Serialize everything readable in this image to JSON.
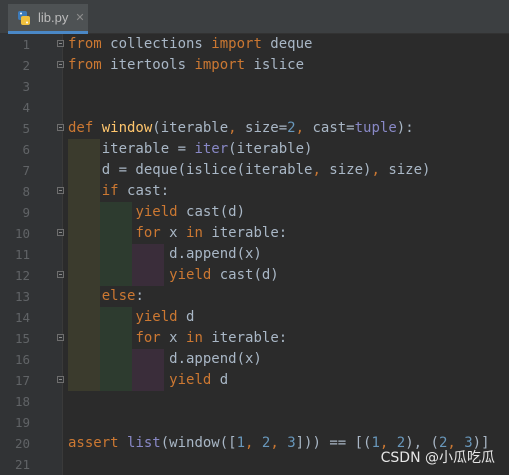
{
  "tab": {
    "filename": "lib.py",
    "close": "✕",
    "icon": "python-file-icon"
  },
  "lines": [
    {
      "n": "1",
      "fold": true,
      "tokens": [
        [
          "kw",
          "from"
        ],
        [
          "t",
          " collections "
        ],
        [
          "kw",
          "import"
        ],
        [
          "t",
          " deque"
        ]
      ]
    },
    {
      "n": "2",
      "fold": true,
      "tokens": [
        [
          "kw",
          "from"
        ],
        [
          "t",
          " itertools "
        ],
        [
          "kw",
          "import"
        ],
        [
          "t",
          " islice"
        ]
      ]
    },
    {
      "n": "3",
      "fold": false,
      "tokens": []
    },
    {
      "n": "4",
      "fold": false,
      "tokens": []
    },
    {
      "n": "5",
      "fold": true,
      "tokens": [
        [
          "kw",
          "def "
        ],
        [
          "fn",
          "window"
        ],
        [
          "t",
          "(iterable"
        ],
        [
          "kw",
          ", "
        ],
        [
          "t",
          "size="
        ],
        [
          "num",
          "2"
        ],
        [
          "kw",
          ", "
        ],
        [
          "t",
          "cast="
        ],
        [
          "bi",
          "tuple"
        ],
        [
          "t",
          "):"
        ]
      ]
    },
    {
      "n": "6",
      "fold": false,
      "tokens": [
        [
          "t",
          "    iterable = "
        ],
        [
          "bi",
          "iter"
        ],
        [
          "t",
          "(iterable)"
        ]
      ]
    },
    {
      "n": "7",
      "fold": false,
      "tokens": [
        [
          "t",
          "    d = deque(islice(iterable"
        ],
        [
          "kw",
          ", "
        ],
        [
          "t",
          "size)"
        ],
        [
          "kw",
          ", "
        ],
        [
          "t",
          "size)"
        ]
      ]
    },
    {
      "n": "8",
      "fold": true,
      "tokens": [
        [
          "t",
          "    "
        ],
        [
          "kw",
          "if "
        ],
        [
          "t",
          "cast:"
        ]
      ]
    },
    {
      "n": "9",
      "fold": false,
      "tokens": [
        [
          "t",
          "        "
        ],
        [
          "kw",
          "yield "
        ],
        [
          "t",
          "cast(d)"
        ]
      ]
    },
    {
      "n": "10",
      "fold": true,
      "tokens": [
        [
          "t",
          "        "
        ],
        [
          "kw",
          "for "
        ],
        [
          "t",
          "x "
        ],
        [
          "kw",
          "in "
        ],
        [
          "t",
          "iterable:"
        ]
      ]
    },
    {
      "n": "11",
      "fold": false,
      "tokens": [
        [
          "t",
          "            d.append(x)"
        ]
      ]
    },
    {
      "n": "12",
      "fold": true,
      "tokens": [
        [
          "t",
          "            "
        ],
        [
          "kw",
          "yield "
        ],
        [
          "t",
          "cast(d)"
        ]
      ]
    },
    {
      "n": "13",
      "fold": false,
      "tokens": [
        [
          "t",
          "    "
        ],
        [
          "kw",
          "else"
        ],
        [
          "t",
          ":"
        ]
      ]
    },
    {
      "n": "14",
      "fold": false,
      "tokens": [
        [
          "t",
          "        "
        ],
        [
          "kw",
          "yield "
        ],
        [
          "t",
          "d"
        ]
      ]
    },
    {
      "n": "15",
      "fold": true,
      "tokens": [
        [
          "t",
          "        "
        ],
        [
          "kw",
          "for "
        ],
        [
          "t",
          "x "
        ],
        [
          "kw",
          "in "
        ],
        [
          "t",
          "iterable:"
        ]
      ]
    },
    {
      "n": "16",
      "fold": false,
      "tokens": [
        [
          "t",
          "            d.append(x)"
        ]
      ]
    },
    {
      "n": "17",
      "fold": true,
      "tokens": [
        [
          "t",
          "            "
        ],
        [
          "kw",
          "yield "
        ],
        [
          "t",
          "d"
        ]
      ]
    },
    {
      "n": "18",
      "fold": false,
      "tokens": []
    },
    {
      "n": "19",
      "fold": false,
      "tokens": []
    },
    {
      "n": "20",
      "fold": false,
      "tokens": [
        [
          "kw",
          "assert "
        ],
        [
          "bi",
          "list"
        ],
        [
          "t",
          "(window(["
        ],
        [
          "num",
          "1"
        ],
        [
          "kw",
          ", "
        ],
        [
          "num",
          "2"
        ],
        [
          "kw",
          ", "
        ],
        [
          "num",
          "3"
        ],
        [
          "t",
          "])) == [("
        ],
        [
          "num",
          "1"
        ],
        [
          "kw",
          ", "
        ],
        [
          "num",
          "2"
        ],
        [
          "t",
          "), ("
        ],
        [
          "num",
          "2"
        ],
        [
          "kw",
          ", "
        ],
        [
          "num",
          "3"
        ],
        [
          "t",
          ")]"
        ]
      ]
    },
    {
      "n": "21",
      "fold": false,
      "tokens": []
    }
  ],
  "watermark": "CSDN @小瓜吃瓜",
  "colors": {
    "background": "#2b2b2b",
    "keyword": "#cc7832",
    "function": "#ffc66d",
    "builtin": "#8888c6",
    "number": "#6897bb",
    "text": "#a9b7c6"
  }
}
